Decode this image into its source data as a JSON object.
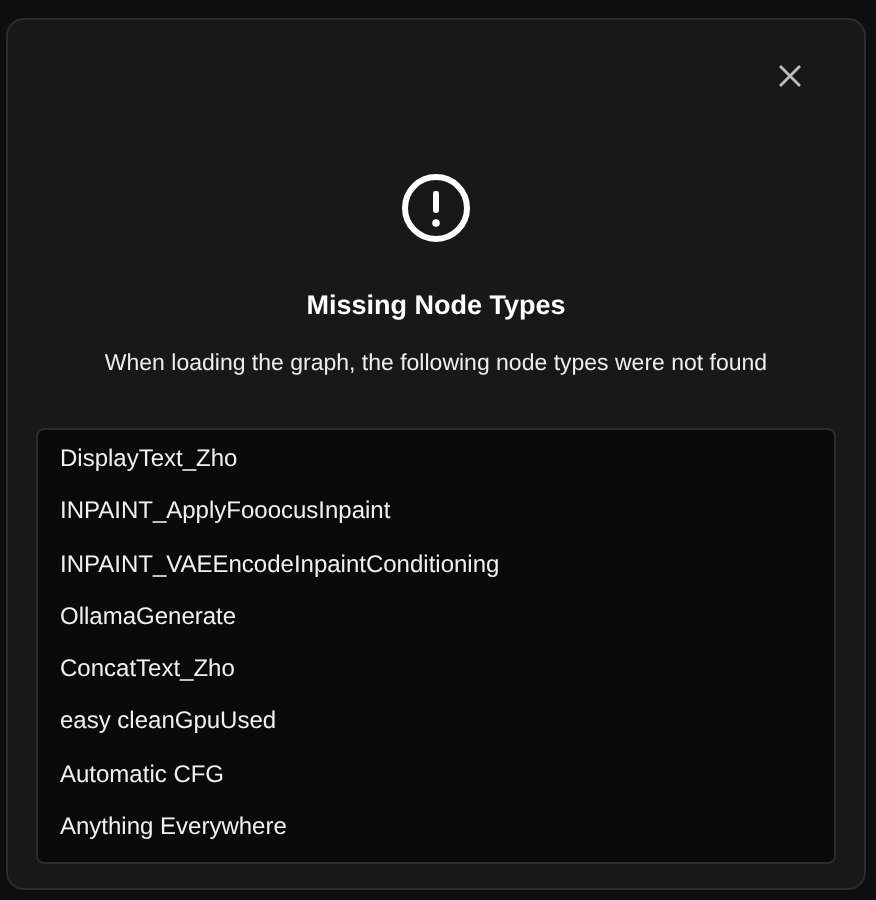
{
  "dialog": {
    "title": "Missing Node Types",
    "message": "When loading the graph, the following node types were not found",
    "missing_nodes": [
      "DisplayText_Zho",
      "INPAINT_ApplyFooocusInpaint",
      "INPAINT_VAEEncodeInpaintConditioning",
      "OllamaGenerate",
      "ConcatText_Zho",
      "easy cleanGpuUsed",
      "Automatic CFG",
      "Anything Everywhere"
    ]
  }
}
